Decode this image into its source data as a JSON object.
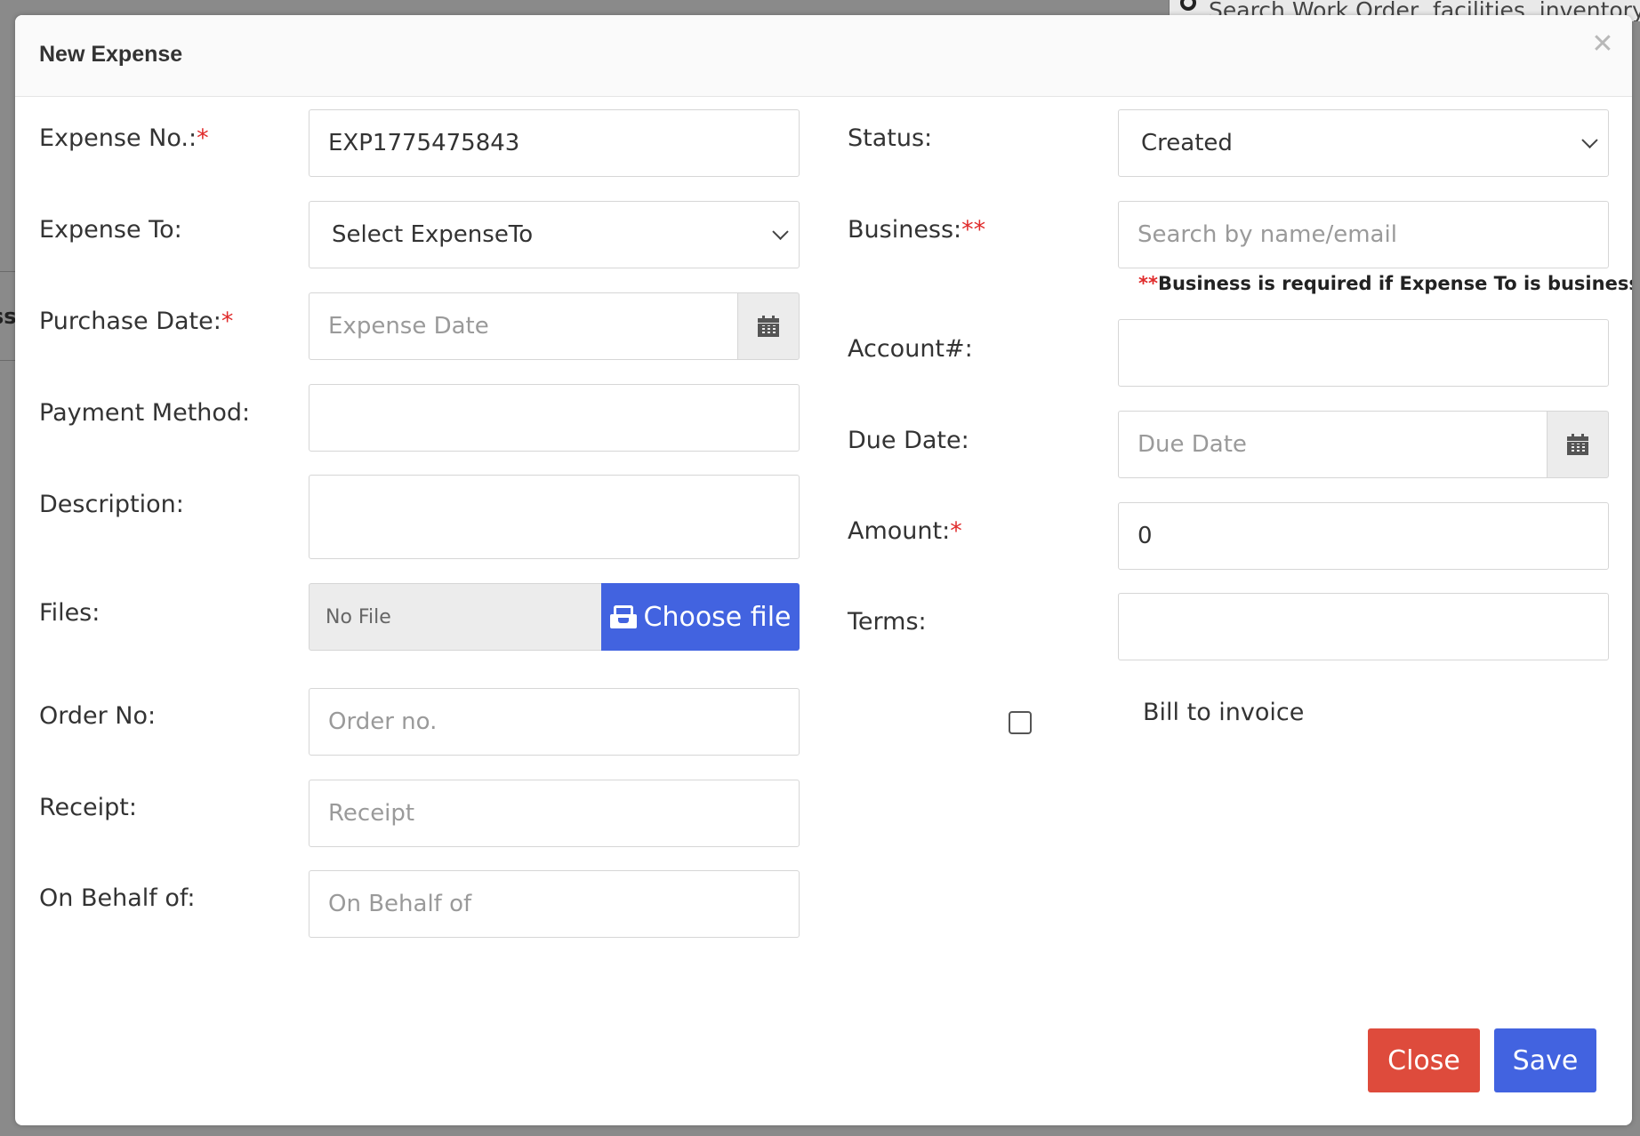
{
  "background": {
    "search_placeholder": "Search Work Order, facilities, inventory",
    "left_fragment": "ss"
  },
  "modal": {
    "title": "New Expense"
  },
  "form": {
    "expense_no": {
      "label": "Expense No.:",
      "required_mark": "*",
      "value": "EXP1775475843"
    },
    "expense_to": {
      "label": "Expense To:",
      "value": "Select ExpenseTo"
    },
    "purchase_date": {
      "label": "Purchase Date:",
      "required_mark": "*",
      "placeholder": "Expense Date"
    },
    "payment_method": {
      "label": "Payment Method:",
      "value": ""
    },
    "description": {
      "label": "Description:",
      "value": ""
    },
    "files": {
      "label": "Files:",
      "no_file_text": "No File",
      "choose_label": "Choose file"
    },
    "order_no": {
      "label": "Order No:",
      "placeholder": "Order no."
    },
    "receipt": {
      "label": "Receipt:",
      "placeholder": "Receipt"
    },
    "on_behalf_of": {
      "label": "On Behalf of:",
      "placeholder": "On Behalf of"
    },
    "status": {
      "label": "Status:",
      "value": "Created"
    },
    "business": {
      "label": "Business:",
      "required_mark": "**",
      "placeholder": "Search by name/email",
      "help_mark": "**",
      "help_text": "Business is required if Expense To is business"
    },
    "account": {
      "label": "Account#:",
      "value": ""
    },
    "due_date": {
      "label": "Due Date:",
      "placeholder": "Due Date"
    },
    "amount": {
      "label": "Amount:",
      "required_mark": "*",
      "value": "0"
    },
    "terms": {
      "label": "Terms:",
      "value": ""
    },
    "bill_to_invoice": {
      "label": "Bill to invoice",
      "checked": false
    }
  },
  "footer": {
    "close_label": "Close",
    "save_label": "Save"
  },
  "colors": {
    "primary": "#4263e0",
    "danger": "#de4b3c",
    "required": "#e02b2b"
  }
}
